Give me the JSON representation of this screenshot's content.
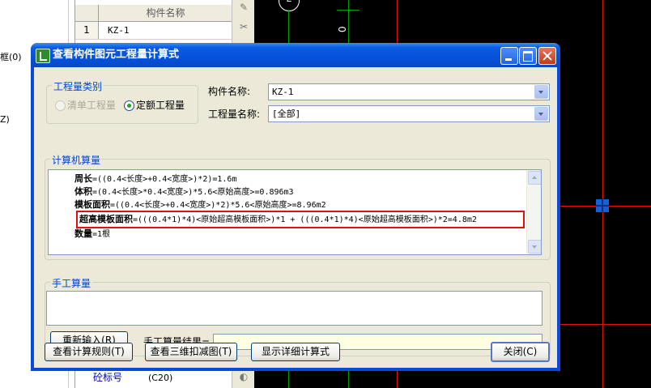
{
  "background": {
    "left_fragments": [
      "框(0)",
      "Z)"
    ],
    "table": {
      "header": "构件名称",
      "row_number": "1",
      "row_value": "KZ-1",
      "bottom_row_label": "砼标号",
      "bottom_row_value": "(C20)"
    },
    "cad": {
      "axis_label": "E",
      "dimension_text": "0"
    }
  },
  "dialog": {
    "title": "查看构件图元工程量计算式",
    "quantity_category": {
      "legend": "工程量类别",
      "options": [
        {
          "label": "清单工程量",
          "checked": false,
          "disabled": true
        },
        {
          "label": "定额工程量",
          "checked": true,
          "disabled": false
        }
      ]
    },
    "component_name": {
      "label": "构件名称:",
      "value": "KZ-1"
    },
    "quantity_name": {
      "label": "工程量名称:",
      "value": "[全部]"
    },
    "computer_calc": {
      "legend": "计算机算量",
      "lines": [
        {
          "name": "周长",
          "formula": "=((0.4<长度>+0.4<宽度>)*2)=1.6m"
        },
        {
          "name": "体积",
          "formula": "=(0.4<长度>*0.4<宽度>)*5.6<原始高度>=0.896m3"
        },
        {
          "name": "模板面积",
          "formula": "=((0.4<长度>+0.4<宽度>)*2)*5.6<原始高度>=8.96m2"
        },
        {
          "name": "超高模板面积",
          "formula": "=(((0.4*1)*4)<原始超高模板面积>)*1 + (((0.4*1)*4)<原始超高模板面积>)*2=4.8m2"
        },
        {
          "name": "数量",
          "formula": "=1根"
        }
      ]
    },
    "manual_calc": {
      "legend": "手工算量",
      "reenter_button": "重新输入(R)",
      "result_label": "手工算量结果="
    },
    "buttons": {
      "view_rules": "查看计算规则(T)",
      "view_3d": "查看三维扣减图(T)",
      "show_detail": "显示详细计算式",
      "close": "关闭(C)"
    }
  }
}
